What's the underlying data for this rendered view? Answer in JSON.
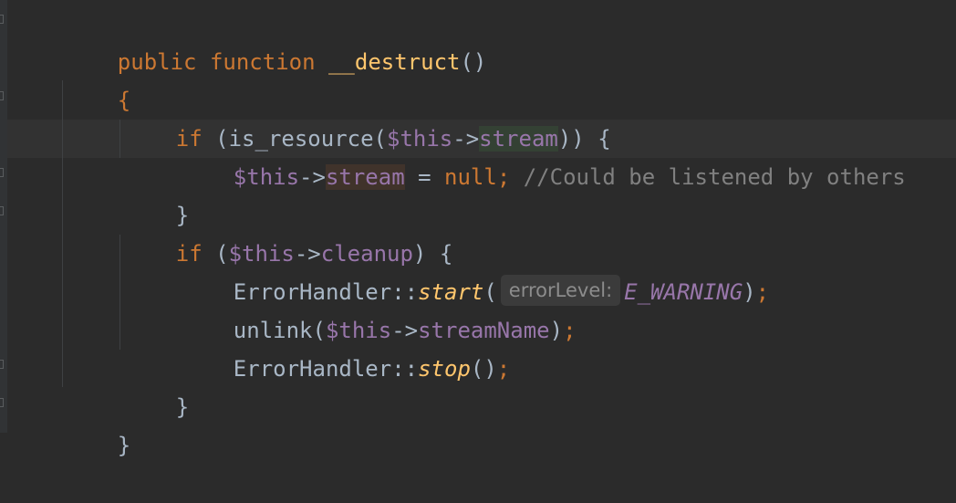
{
  "colors": {
    "background": "#2b2b2b",
    "keyword": "#cc7832",
    "function": "#ffc66d",
    "variable": "#9876aa",
    "text": "#a9b7c6",
    "comment": "#808080"
  },
  "code": {
    "l1": {
      "kw": "public function ",
      "fn": "__destruct",
      "paren": "()"
    },
    "l2": {
      "brace": "{"
    },
    "l3": {
      "kw": "if ",
      "p1": "(is_resource(",
      "var": "$this",
      "arrow": "->",
      "prop": "stream",
      "p2": ")) {"
    },
    "l4": {
      "var": "$this",
      "arrow": "->",
      "prop": "stream",
      "eq": " = ",
      "null": "null",
      "semi": ";",
      "comment": " //Could be listened by others"
    },
    "l5": {
      "brace": "}"
    },
    "l6": {
      "kw": "if ",
      "p1": "(",
      "var": "$this",
      "arrow": "->",
      "prop": "cleanup",
      "p2": ") {"
    },
    "l7": {
      "cls": "ErrorHandler::",
      "method": "start",
      "p1": "(",
      "hint": "errorLevel:",
      "const": "E_WARNING",
      "p2": ")",
      "semi": ";"
    },
    "l8": {
      "fn": "unlink(",
      "var": "$this",
      "arrow": "->",
      "prop": "streamName",
      "p2": ")",
      "semi": ";"
    },
    "l9": {
      "cls": "ErrorHandler::",
      "method": "stop",
      "p1": "()",
      "semi": ";"
    },
    "l10": {
      "brace": "}"
    },
    "l11": {
      "brace": "}"
    }
  }
}
